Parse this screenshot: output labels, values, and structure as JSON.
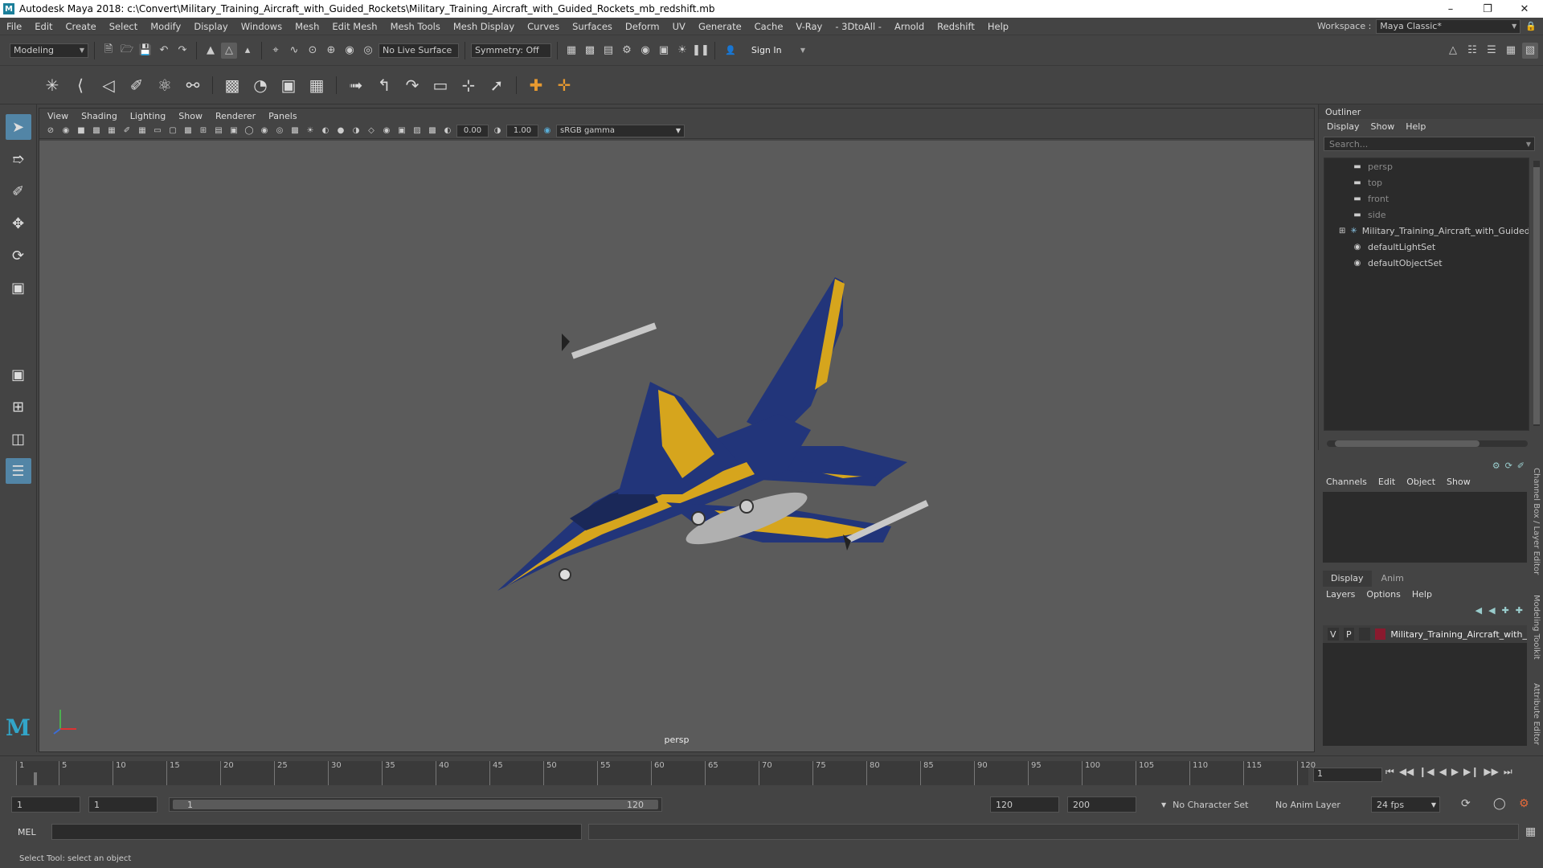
{
  "window": {
    "title": "Autodesk Maya 2018: c:\\Convert\\Military_Training_Aircraft_with_Guided_Rockets\\Military_Training_Aircraft_with_Guided_Rockets_mb_redshift.mb",
    "logo": "M"
  },
  "menu": [
    "File",
    "Edit",
    "Create",
    "Select",
    "Modify",
    "Display",
    "Windows",
    "Mesh",
    "Edit Mesh",
    "Mesh Tools",
    "Mesh Display",
    "Curves",
    "Surfaces",
    "Deform",
    "UV",
    "Generate",
    "Cache",
    "V-Ray",
    "- 3DtoAll -",
    "Arnold",
    "Redshift",
    "Help"
  ],
  "workspace": {
    "label": "Workspace :",
    "value": "Maya Classic*"
  },
  "status": {
    "mode": "Modeling",
    "live_surface": "No Live Surface",
    "symmetry": "Symmetry: Off",
    "sign_in": "Sign In"
  },
  "viewport": {
    "menu": [
      "View",
      "Shading",
      "Lighting",
      "Show",
      "Renderer",
      "Panels"
    ],
    "exposure": "0.00",
    "gamma": "1.00",
    "color_space": "sRGB gamma",
    "camera": "persp"
  },
  "outliner": {
    "title": "Outliner",
    "menu": [
      "Display",
      "Show",
      "Help"
    ],
    "search_placeholder": "Search...",
    "items": [
      {
        "label": "persp",
        "dim": true
      },
      {
        "label": "top",
        "dim": true
      },
      {
        "label": "front",
        "dim": true
      },
      {
        "label": "side",
        "dim": true
      },
      {
        "label": "Military_Training_Aircraft_with_Guided_R",
        "dim": false
      },
      {
        "label": "defaultLightSet",
        "dim": false
      },
      {
        "label": "defaultObjectSet",
        "dim": false
      }
    ]
  },
  "channelbox": {
    "menu": [
      "Channels",
      "Edit",
      "Object",
      "Show"
    ]
  },
  "layers": {
    "tabs": [
      "Display",
      "Anim"
    ],
    "menu": [
      "Layers",
      "Options",
      "Help"
    ],
    "row": {
      "v": "V",
      "p": "P",
      "name": "Military_Training_Aircraft_with_"
    }
  },
  "sidetabs": [
    "Channel Box / Layer Editor",
    "Modeling Toolkit",
    "Attribute Editor"
  ],
  "timeline": {
    "ticks": [
      "1",
      "5",
      "10",
      "15",
      "20",
      "25",
      "30",
      "35",
      "40",
      "45",
      "50",
      "55",
      "60",
      "65",
      "70",
      "75",
      "80",
      "85",
      "90",
      "95",
      "100",
      "105",
      "110",
      "115",
      "120"
    ],
    "current_frame": "1"
  },
  "range": {
    "start": "1",
    "anim_start": "1",
    "slider_lo": "1",
    "slider_hi": "120",
    "end": "120",
    "anim_end": "200",
    "character_set": "No Character Set",
    "anim_layer": "No Anim Layer",
    "fps": "24 fps"
  },
  "mel": {
    "label": "MEL"
  },
  "help_line": "Select Tool: select an object",
  "colors": {
    "accent": "#5285a6",
    "aircraft_blue": "#22357a",
    "aircraft_yellow": "#d6a51d",
    "layer_color": "#8a1a2e"
  }
}
